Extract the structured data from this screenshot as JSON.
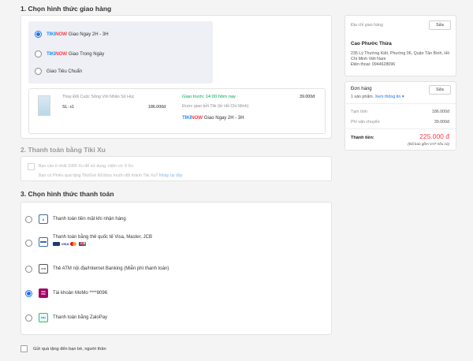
{
  "shipping": {
    "title": "1. Chọn hình thức giao hàng",
    "options": [
      {
        "brand_a": "TIKI",
        "brand_b": "NOW",
        "label": "Giao Ngay 2H - 3H",
        "selected": true
      },
      {
        "brand_a": "TIKI",
        "brand_b": "NOW",
        "label": "Giao Trong Ngày",
        "selected": false
      },
      {
        "brand_a": "",
        "brand_b": "",
        "label": "Giao Tiêu Chuẩn",
        "selected": false
      }
    ],
    "package": {
      "product_name": "Thay Đổi Cuộc Sống Với Nhân Số Học",
      "qty": "SL: x1",
      "price": "186.000đ",
      "delivery_time": "Giao trước 14:00 hôm nay",
      "delivered_by": "Được giao bởi Tiki (từ Hồ Chí Minh)",
      "brand_a": "TIKI",
      "brand_b": "NOW",
      "method": "Giao Ngay 2H - 3H",
      "ship_fee": "39.000đ"
    }
  },
  "tiki_xu": {
    "title": "2. Thanh toán bằng Tiki Xu",
    "note1": "Bạn cần ít nhất 1000 Xu để sử dụng. Hiện có: 0 Xu",
    "note2": "Bạn có Phiếu quà tặng Tiki/Got It/Urbox muốn đổi thành Tiki Xu?",
    "link": "Nhập tại đây"
  },
  "payment": {
    "title": "3. Chọn hình thức thanh toán",
    "options": [
      {
        "label": "Thanh toán tiền mặt khi nhận hàng",
        "icon": "cash-icon",
        "selected": false
      },
      {
        "label": "Thanh toán bằng thẻ quốc tế Visa, Master, JCB",
        "icon": "credit-card-icon",
        "selected": false
      },
      {
        "label": "Thẻ ATM nội địa/Internet Banking (Miễn phí thanh toán)",
        "icon": "atm-card-icon",
        "selected": false
      },
      {
        "label": "Tài khoản MoMo ****8096",
        "icon": "momo-icon",
        "selected": true
      },
      {
        "label": "Thanh toán bằng ZaloPay",
        "icon": "zalopay-icon",
        "selected": false
      }
    ],
    "card_logos": [
      "VISA",
      "JCB"
    ],
    "momo_text": "mo\nmo",
    "zalo_text": "Zalo"
  },
  "gift": {
    "label": "Gửi quà tặng đến bạn bè, người thân"
  },
  "address": {
    "title": "Địa chỉ giao hàng",
    "edit": "Sửa",
    "name": "Cao Phước Thừa",
    "line": "235 Lý Thường Kiệt, Phường 06, Quận Tân Bình, Hồ Chí Minh Việt Nam",
    "phone": "Điện thoại: 0944628096"
  },
  "order": {
    "title": "Đơn hàng",
    "edit": "Sửa",
    "count": "1 sản phẩm.",
    "view": "Xem thông tin",
    "subtotal_label": "Tạm tính",
    "subtotal": "186.000đ",
    "shipping_label": "Phí vận chuyển",
    "shipping": "39.000đ",
    "total_label": "Thành tiền:",
    "total": "225.000 đ",
    "vat": "(Đã bao gồm VAT nếu có)"
  },
  "colors": {
    "accent": "#1a73e8",
    "price": "#ff424e",
    "green": "#00ab56",
    "tiki": "#1a94ff"
  }
}
